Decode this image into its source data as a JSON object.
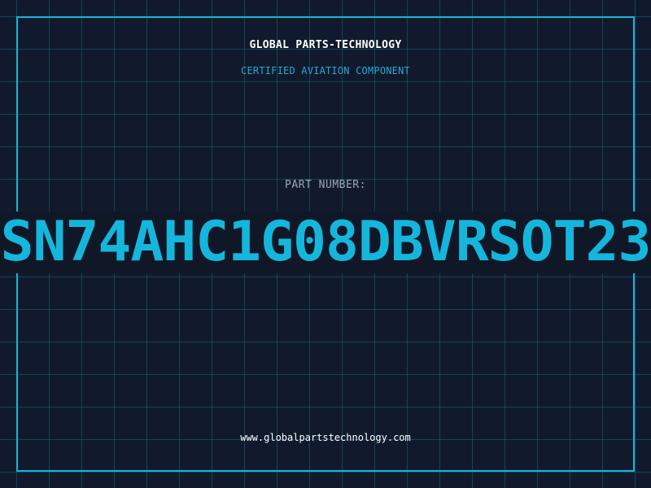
{
  "header": {
    "company_name": "GLOBAL PARTS-TECHNOLOGY",
    "subtitle": "CERTIFIED AVIATION COMPONENT"
  },
  "part": {
    "label": "PART NUMBER:",
    "number": "SN74AHC1G08DBVRSOT23"
  },
  "footer": {
    "website": "www.globalpartstechnology.com"
  },
  "colors": {
    "background": "#111a2c",
    "accent": "#12b6d8",
    "subtitle": "#2aa6d6",
    "label": "#9aa8b8"
  }
}
